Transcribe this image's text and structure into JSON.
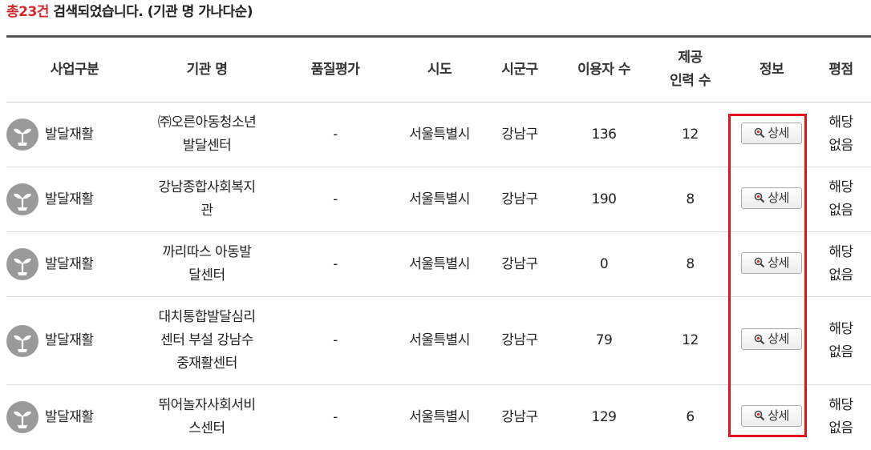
{
  "summary": {
    "count_text": "총23건",
    "rest_text": " 검색되었습니다. (기관 명 가나다순)"
  },
  "colors": {
    "accent_red": "#d7262b",
    "highlight_box": "#e0121b"
  },
  "table": {
    "headers": {
      "business_type": "사업구분",
      "org_name": "기관 명",
      "quality": "품질평가",
      "province": "시도",
      "district": "시군구",
      "users": "이용자 수",
      "staff_line1": "제공",
      "staff_line2": "인력 수",
      "info": "정보",
      "rating": "평점"
    },
    "detail_button_label": "상세",
    "detail_icon": "magnifier-icon",
    "type_icon": "sprout-icon",
    "rows": [
      {
        "type": "발달재활",
        "name": "㈜오른아동청소년발달센터",
        "quality": "-",
        "province": "서울특별시",
        "district": "강남구",
        "users": "136",
        "staff": "12",
        "rating": "해당없음"
      },
      {
        "type": "발달재활",
        "name": "강남종합사회복지관",
        "quality": "-",
        "province": "서울특별시",
        "district": "강남구",
        "users": "190",
        "staff": "8",
        "rating": "해당없음"
      },
      {
        "type": "발달재활",
        "name": "까리따스 아동발달센터",
        "quality": "-",
        "province": "서울특별시",
        "district": "강남구",
        "users": "0",
        "staff": "8",
        "rating": "해당없음"
      },
      {
        "type": "발달재활",
        "name": "대치통합발달심리센터 부설 강남수중재활센터",
        "quality": "-",
        "province": "서울특별시",
        "district": "강남구",
        "users": "79",
        "staff": "12",
        "rating": "해당없음"
      },
      {
        "type": "발달재활",
        "name": "뛰어놀자사회서비스센터",
        "quality": "-",
        "province": "서울특별시",
        "district": "강남구",
        "users": "129",
        "staff": "6",
        "rating": "해당없음"
      }
    ]
  }
}
